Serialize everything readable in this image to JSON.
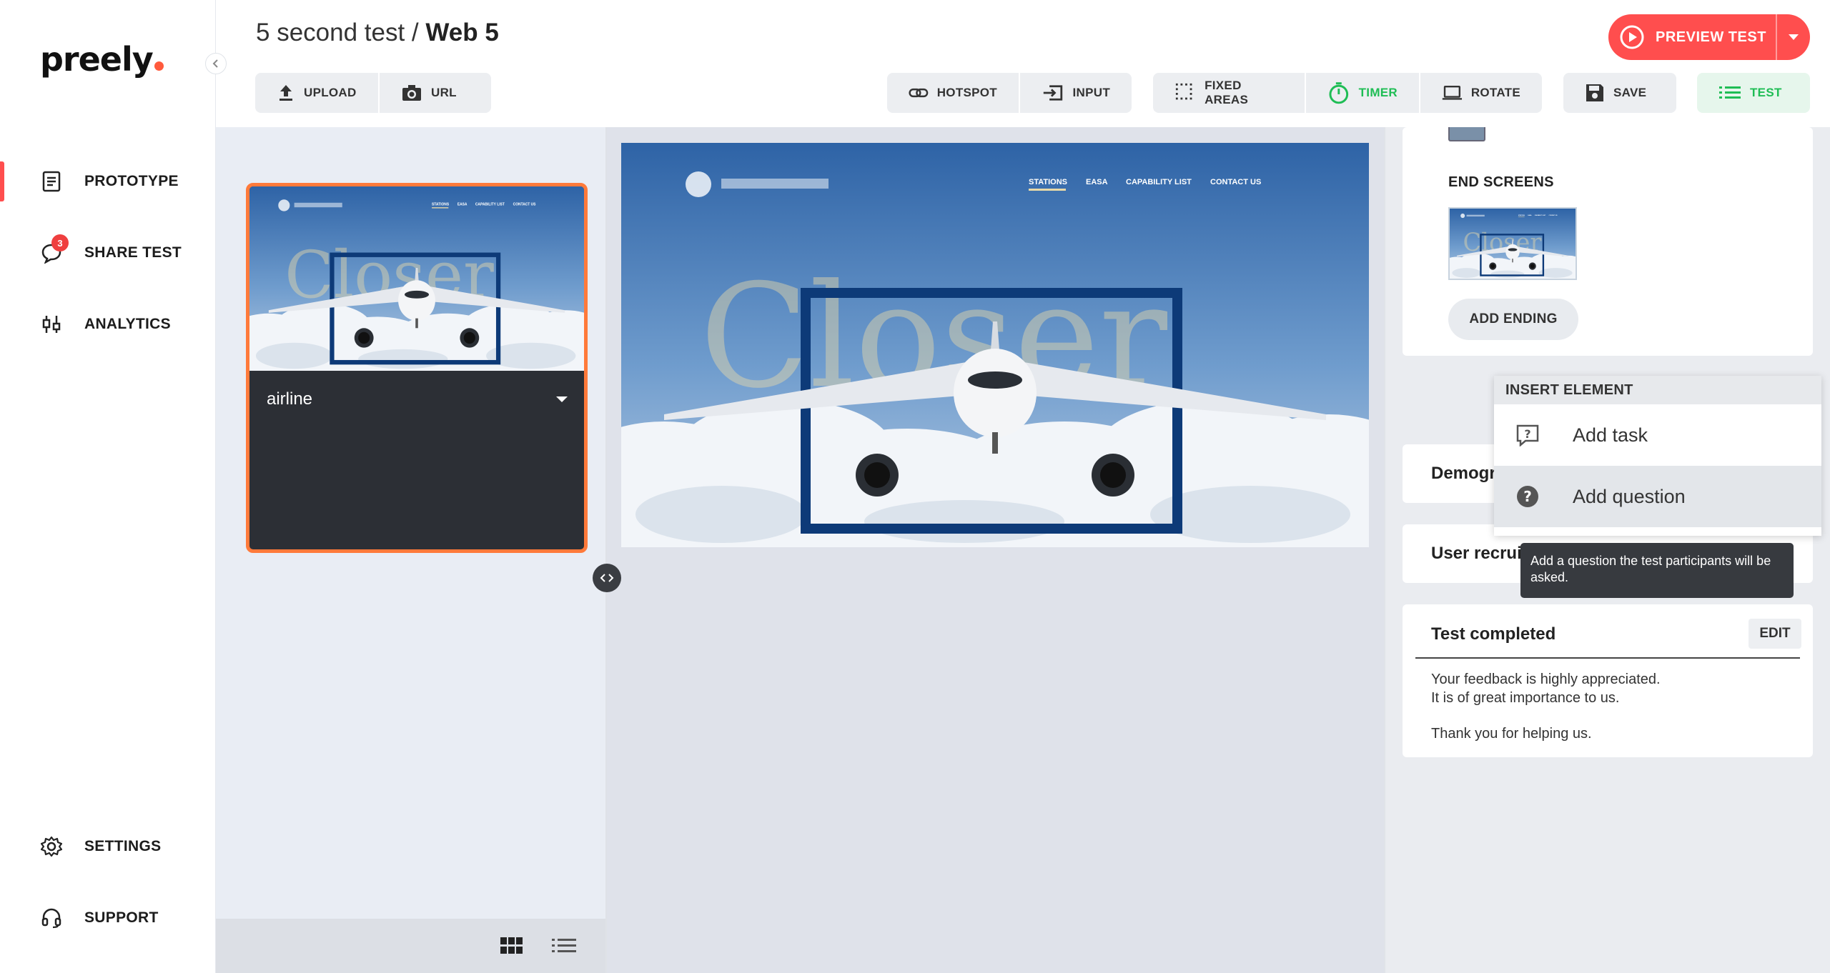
{
  "app": {
    "logo": "preely"
  },
  "sidebar": {
    "items": [
      {
        "label": "PROTOTYPE",
        "icon": "document-icon",
        "active": true
      },
      {
        "label": "SHARE TEST",
        "icon": "chat-bubble-icon",
        "badge": "3"
      },
      {
        "label": "ANALYTICS",
        "icon": "analytics-icon"
      },
      {
        "label": "SETTINGS",
        "icon": "gear-icon"
      },
      {
        "label": "SUPPORT",
        "icon": "headset-icon"
      }
    ]
  },
  "header": {
    "breadcrumb_type": "5 second test /",
    "project_name": "Web 5",
    "preview_label": "PREVIEW TEST"
  },
  "toolbar": {
    "upload": "UPLOAD",
    "url": "URL",
    "hotspot": "HOTSPOT",
    "input": "INPUT",
    "fixed_areas": "FIXED AREAS",
    "timer": "TIMER",
    "rotate": "ROTATE",
    "save": "SAVE",
    "test": "TEST"
  },
  "screens": {
    "items": [
      {
        "name": "airline",
        "selected": true
      }
    ]
  },
  "right_panel": {
    "end_screens_label": "END SCREENS",
    "add_ending": "ADD ENDING",
    "demographics_label": "Demographics",
    "user_recruit_label": "User recruitment",
    "completed": {
      "title": "Test completed",
      "edit": "EDIT",
      "line1": "Your feedback is highly appreciated.",
      "line2": "It is of great importance to us.",
      "line3": "Thank you for helping us."
    }
  },
  "insert_menu": {
    "header": "INSERT ELEMENT",
    "items": [
      {
        "label": "Add task",
        "icon": "task-icon"
      },
      {
        "label": "Add question",
        "icon": "question-circle-icon"
      }
    ],
    "tooltip": "Add a question the test participants will be asked."
  },
  "colors": {
    "accent": "#ff4e4e",
    "selected_border": "#ff7a3a",
    "timer_green": "#1fbd55",
    "sky": "#3f74b0",
    "frame_navy": "#0d3a78"
  }
}
